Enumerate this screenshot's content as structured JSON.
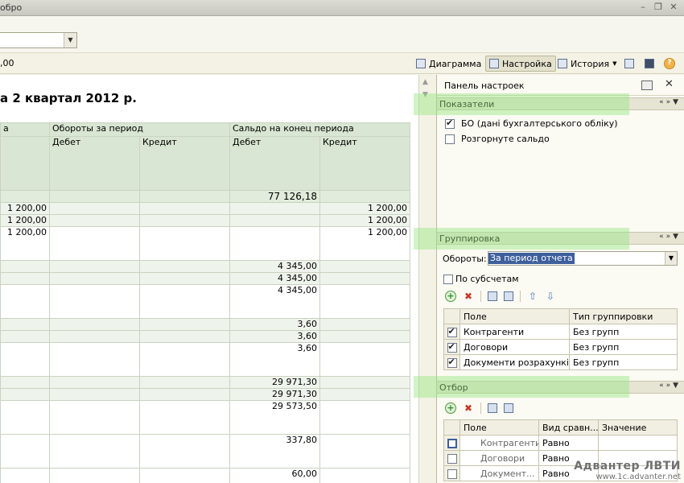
{
  "window": {
    "title": "обро"
  },
  "toolbar": {
    "amount": ",00",
    "diagram_label": "Диаграмма",
    "settings_label": "Настройка",
    "history_label": "История"
  },
  "report": {
    "title": "а 2 квартал 2012 р.",
    "header_col0": "а",
    "header_turnover": "Обороты за период",
    "header_balance_end": "Сальдо на конец периода",
    "debit": "Дебет",
    "credit": "Кредит",
    "rows": [
      {
        "c0": "",
        "c3": "77 126,18",
        "c4": ""
      },
      {
        "c0": "1 200,00",
        "c3": "",
        "c4": "1 200,00"
      },
      {
        "c0": "1 200,00",
        "c3": "",
        "c4": "1 200,00"
      },
      {
        "c0": "1 200,00",
        "c3": "",
        "c4": "1 200,00"
      },
      {
        "c0": "",
        "c3": "4 345,00",
        "c4": ""
      },
      {
        "c0": "",
        "c3": "4 345,00",
        "c4": ""
      },
      {
        "c0": "",
        "c3": "4 345,00",
        "c4": ""
      },
      {
        "c0": "",
        "c3": "3,60",
        "c4": ""
      },
      {
        "c0": "",
        "c3": "3,60",
        "c4": ""
      },
      {
        "c0": "",
        "c3": "3,60",
        "c4": ""
      },
      {
        "c0": "",
        "c3": "29 971,30",
        "c4": ""
      },
      {
        "c0": "",
        "c3": "29 971,30",
        "c4": ""
      },
      {
        "c0": "",
        "c3": "29 573,50",
        "c4": ""
      },
      {
        "c0": "",
        "c3": "337,80",
        "c4": ""
      },
      {
        "c0": "",
        "c3": "60,00",
        "c4": ""
      }
    ]
  },
  "panel": {
    "title": "Панель настроек",
    "indicators": {
      "title": "Показатели",
      "items": [
        {
          "label": "БО (дані бухгалтерського обліку)",
          "checked": true
        },
        {
          "label": "Розгорнуте сальдо",
          "checked": false
        }
      ]
    },
    "grouping": {
      "title": "Группировка",
      "turnover_label": "Обороты:",
      "turnover_value": "За период отчета",
      "by_subaccounts": "По субсчетам",
      "col_field": "Поле",
      "col_type": "Тип группировки",
      "rows": [
        {
          "field": "Контрагенти",
          "type": "Без групп"
        },
        {
          "field": "Договори",
          "type": "Без групп"
        },
        {
          "field": "Документи розрахункі...",
          "type": "Без групп"
        }
      ]
    },
    "filter": {
      "title": "Отбор",
      "col_field": "Поле",
      "col_compare": "Вид сравн...",
      "col_value": "Значение",
      "rows": [
        {
          "field": "Контрагенти",
          "compare": "Равно",
          "value": ""
        },
        {
          "field": "Договори",
          "compare": "Равно",
          "value": ""
        },
        {
          "field": "Документ...",
          "compare": "Равно",
          "value": ""
        }
      ]
    }
  },
  "watermark": {
    "line1": "Адвантер ЛВТИ",
    "line2": "www.1c.advanter.net"
  },
  "colors": {
    "header_green": "#d9e6d3",
    "highlight": "#96e682",
    "selection": "#3d5f9c"
  }
}
